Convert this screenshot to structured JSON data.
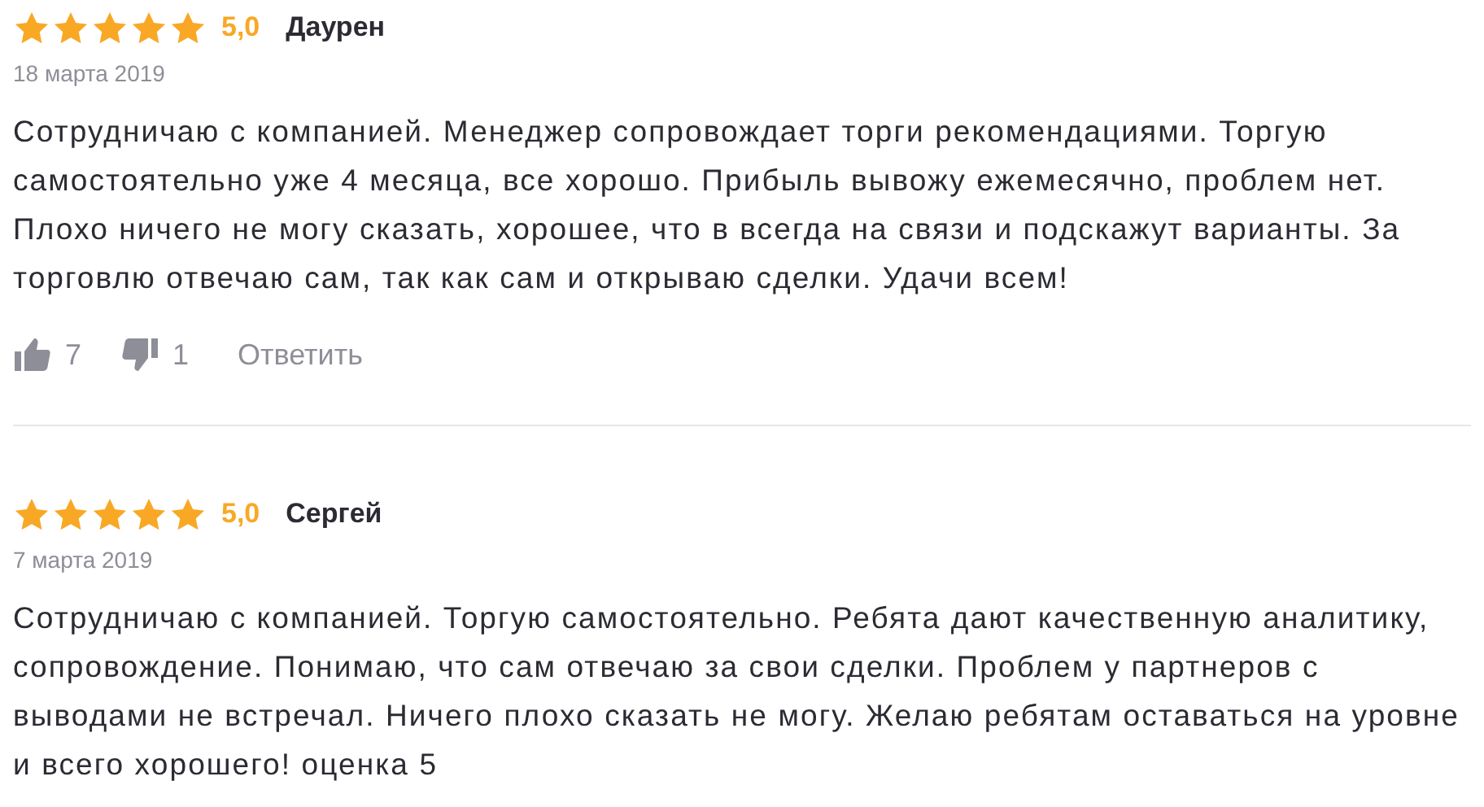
{
  "reviews": [
    {
      "stars": 5,
      "rating": "5,0",
      "author": "Даурен",
      "date": "18 марта 2019",
      "text": "Сотрудничаю с компанией. Менеджер сопровождает торги рекомендациями. Торгую самостоятельно уже 4 месяца, все хорошо. Прибыль вывожу ежемесячно, проблем нет. Плохо ничего не могу сказать, хорошее, что в всегда на связи и подскажут варианты. За торговлю отвечаю сам, так как сам и открываю сделки. Удачи всем!",
      "likes": "7",
      "dislikes": "1",
      "reply": "Ответить"
    },
    {
      "stars": 5,
      "rating": "5,0",
      "author": "Сергей",
      "date": "7 марта 2019",
      "text": "Сотрудничаю с компанией. Торгую самостоятельно. Ребята дают качественную аналитику, сопровождение. Понимаю, что сам отвечаю за свои сделки. Проблем у партнеров с выводами не встречал. Ничего плохо сказать не могу. Желаю ребятам оставаться на уровне и всего хорошего! оценка 5"
    }
  ]
}
